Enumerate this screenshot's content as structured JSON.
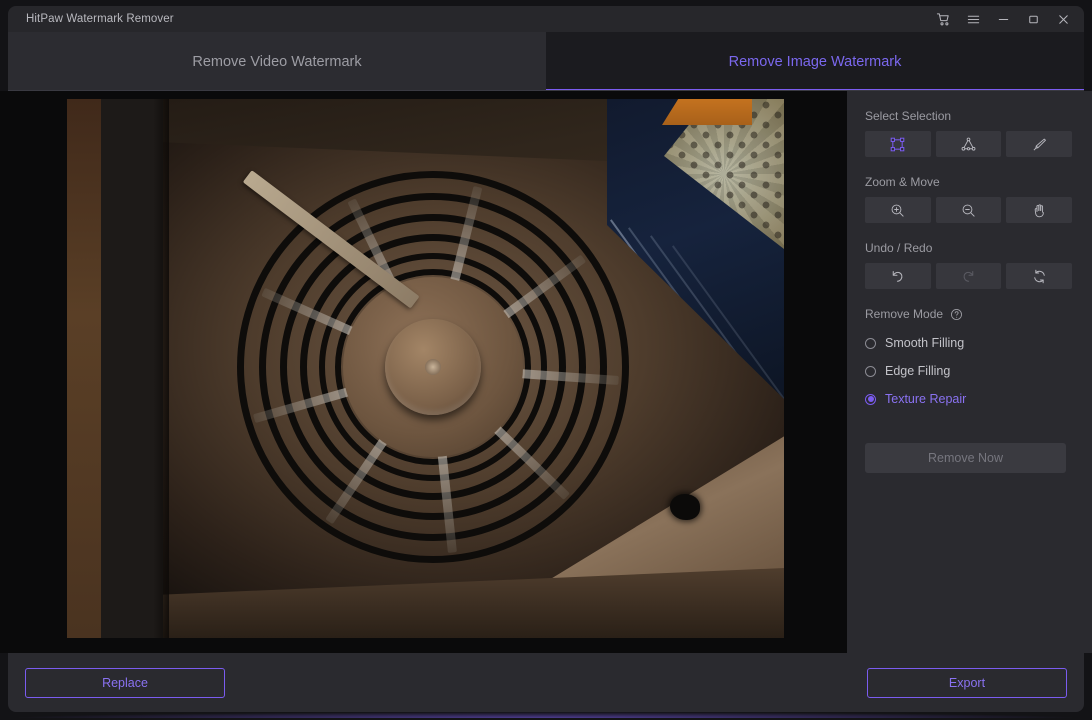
{
  "window": {
    "title": "HitPaw Watermark Remover",
    "controls": [
      {
        "name": "cart-icon",
        "label": "Cart"
      },
      {
        "name": "menu-icon",
        "label": "Menu"
      },
      {
        "name": "minimize-icon",
        "label": "Minimize"
      },
      {
        "name": "maximize-icon",
        "label": "Maximize"
      },
      {
        "name": "close-icon",
        "label": "Close"
      }
    ]
  },
  "tabs": [
    {
      "label": "Remove Video Watermark",
      "active": false
    },
    {
      "label": "Remove Image Watermark",
      "active": true
    }
  ],
  "sidebar": {
    "select_selection": {
      "label": "Select Selection",
      "tools": [
        {
          "icon": "rectangle-select-icon",
          "label": "Rectangle Select",
          "active": true,
          "disabled": false
        },
        {
          "icon": "polygon-select-icon",
          "label": "Polygon Select",
          "active": false,
          "disabled": false
        },
        {
          "icon": "brush-select-icon",
          "label": "Brush Select",
          "active": false,
          "disabled": false
        }
      ]
    },
    "zoom_move": {
      "label": "Zoom & Move",
      "tools": [
        {
          "icon": "zoom-in-icon",
          "label": "Zoom In",
          "active": false,
          "disabled": false
        },
        {
          "icon": "zoom-out-icon",
          "label": "Zoom Out",
          "active": false,
          "disabled": false
        },
        {
          "icon": "hand-pan-icon",
          "label": "Pan",
          "active": false,
          "disabled": false
        }
      ]
    },
    "undo_redo": {
      "label": "Undo / Redo",
      "tools": [
        {
          "icon": "undo-icon",
          "label": "Undo",
          "active": false,
          "disabled": false
        },
        {
          "icon": "redo-icon",
          "label": "Redo",
          "active": false,
          "disabled": true
        },
        {
          "icon": "reset-icon",
          "label": "Reset",
          "active": false,
          "disabled": false
        }
      ]
    },
    "remove_mode": {
      "label": "Remove Mode",
      "help_icon": "help-circle-icon",
      "options": [
        {
          "label": "Smooth Filling",
          "selected": false
        },
        {
          "label": "Edge Filling",
          "selected": false
        },
        {
          "label": "Texture Repair",
          "selected": true
        }
      ]
    },
    "remove_now": {
      "label": "Remove Now",
      "disabled": true
    }
  },
  "footer": {
    "replace_label": "Replace",
    "export_label": "Export"
  },
  "canvas": {
    "image_description": "Photograph of a dark metal enclosure containing a large industrial fan with radial blades and a concentric wire grille; a pale wooden plank runs along the left edge, a blue panel and honeycomb-patterned sheet appear at upper right."
  },
  "colors": {
    "accent": "#7b5cf0",
    "accent_text": "#8a72f2",
    "titlebar_bg": "#27272b",
    "sidebar_bg": "#2a2a2f",
    "tab_inactive_bg": "#2c2c31",
    "tab_active_bg": "#1b1b1f",
    "canvas_bg": "#0a0a0b",
    "tool_btn_bg": "#37373d",
    "muted_text": "#9b9ba2"
  }
}
